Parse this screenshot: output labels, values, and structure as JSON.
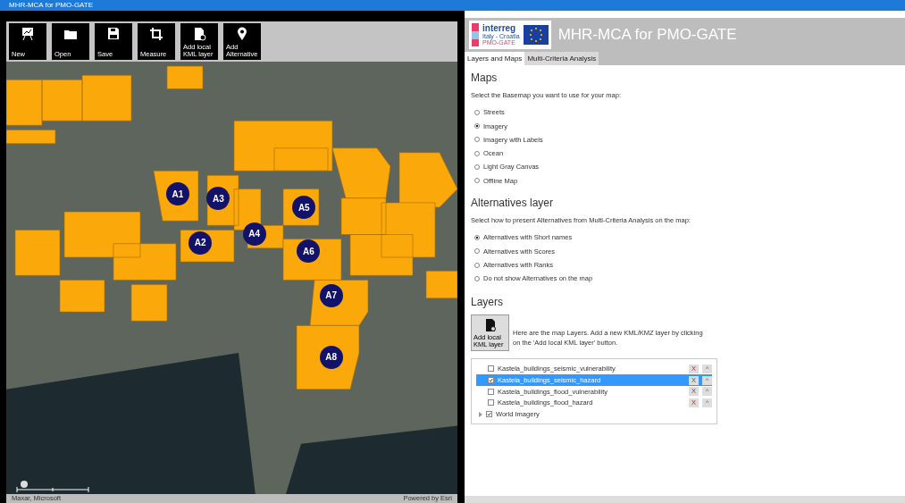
{
  "window": {
    "title": "MHR-MCA for PMO-GATE"
  },
  "toolbar": [
    {
      "label": "New"
    },
    {
      "label": "Open"
    },
    {
      "label": "Save"
    },
    {
      "label": "Measure"
    },
    {
      "label": "Add local KML layer"
    },
    {
      "label": "Add Alternative"
    }
  ],
  "map": {
    "markers": [
      "A1",
      "A3",
      "A5",
      "A4",
      "A2",
      "A6",
      "A7",
      "A8"
    ],
    "attribution": "Maxar, Microsoft",
    "powered_by": "Powered by Esri"
  },
  "header": {
    "logo_text": "interreg",
    "logo_sub": "Italy - Croatia",
    "logo_project": "PMO-GATE",
    "title": "MHR-MCA for PMO-GATE"
  },
  "tabs": [
    {
      "label": "Layers and Maps",
      "selected": true
    },
    {
      "label": "Multi-Criteria Analysis",
      "selected": false
    }
  ],
  "maps": {
    "heading": "Maps",
    "prompt": "Select the Basemap you want to use for your map:",
    "options": [
      {
        "label": "Streets",
        "selected": false
      },
      {
        "label": "Imagery",
        "selected": true
      },
      {
        "label": "Imagery with Labels",
        "selected": false
      },
      {
        "label": "Ocean",
        "selected": false
      },
      {
        "label": "Light Gray Canvas",
        "selected": false
      },
      {
        "label": "Offline Map",
        "selected": false
      }
    ]
  },
  "alternatives": {
    "heading": "Alternatives layer",
    "prompt": "Select how to present Alternatives from Multi-Criteria Analysis on the map:",
    "options": [
      {
        "label": "Alternatives with Short names",
        "selected": true
      },
      {
        "label": "Alternatives with Scores",
        "selected": false
      },
      {
        "label": "Alternatives with Ranks",
        "selected": false
      },
      {
        "label": "Do not show Alternatives on the map",
        "selected": false
      }
    ]
  },
  "layers": {
    "heading": "Layers",
    "add_button": "Add local KML layer",
    "info": "Here are the map Layers. Add a new KML/KMZ layer by clicking on the 'Add local KML layer' button.",
    "items": [
      {
        "kind": "layer",
        "name": "Kastela_buildings_seismic_vulnerability",
        "checked": false,
        "selected": false,
        "remove": "X",
        "up": "^"
      },
      {
        "kind": "layer",
        "name": "Kastela_buildings_seismic_hazard",
        "checked": true,
        "selected": true,
        "remove": "X",
        "up": "^"
      },
      {
        "kind": "layer",
        "name": "Kastela_buildings_flood_vulnerability",
        "checked": false,
        "selected": false,
        "remove": "X",
        "up": "^"
      },
      {
        "kind": "layer",
        "name": "Kastela_buildings_flood_hazard",
        "checked": false,
        "selected": false,
        "remove": "X",
        "up": "^"
      },
      {
        "kind": "basemap",
        "name": "World Imagery",
        "checked": true,
        "selected": false
      }
    ]
  }
}
